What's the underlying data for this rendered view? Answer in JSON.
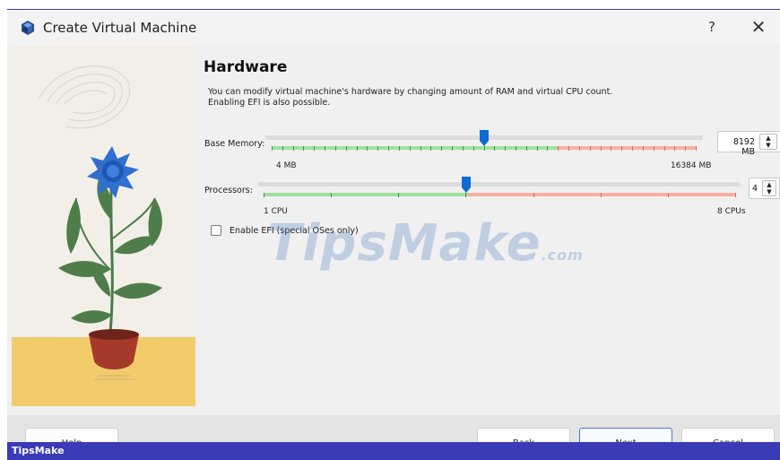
{
  "window": {
    "title": "Create Virtual Machine",
    "help_symbol": "?",
    "close_symbol": "✕"
  },
  "page": {
    "heading": "Hardware",
    "description": "You can modify virtual machine's hardware by changing amount of RAM and virtual CPU count. Enabling EFI is also possible."
  },
  "memory": {
    "label": "Base Memory:",
    "min_label": "4 MB",
    "max_label": "16384 MB",
    "value_display": "8192 MB",
    "value": 8192,
    "min": 4,
    "max": 16384
  },
  "processors": {
    "label": "Processors:",
    "min_label": "1 CPU",
    "max_label": "8 CPUs",
    "value_display": "4",
    "value": 4,
    "min": 1,
    "max": 8
  },
  "efi": {
    "label": "Enable EFI (special OSes only)",
    "checked": false
  },
  "footer": {
    "help_label": "Help",
    "back_label": "Back",
    "next_label": "Next",
    "cancel_label": "Cancel"
  },
  "watermark": {
    "main": "TipsMake",
    "suffix": ".com"
  },
  "brand_bar": {
    "label": "TipsMake"
  },
  "colors": {
    "accent": "#0a6ad6",
    "safe_zone": "#8fdc8f",
    "warn_zone": "#f2a89a",
    "brand": "#3b3bb8"
  },
  "icons": [
    "virtualbox-icon",
    "help-icon",
    "close-icon",
    "spin-up-icon",
    "spin-down-icon"
  ]
}
